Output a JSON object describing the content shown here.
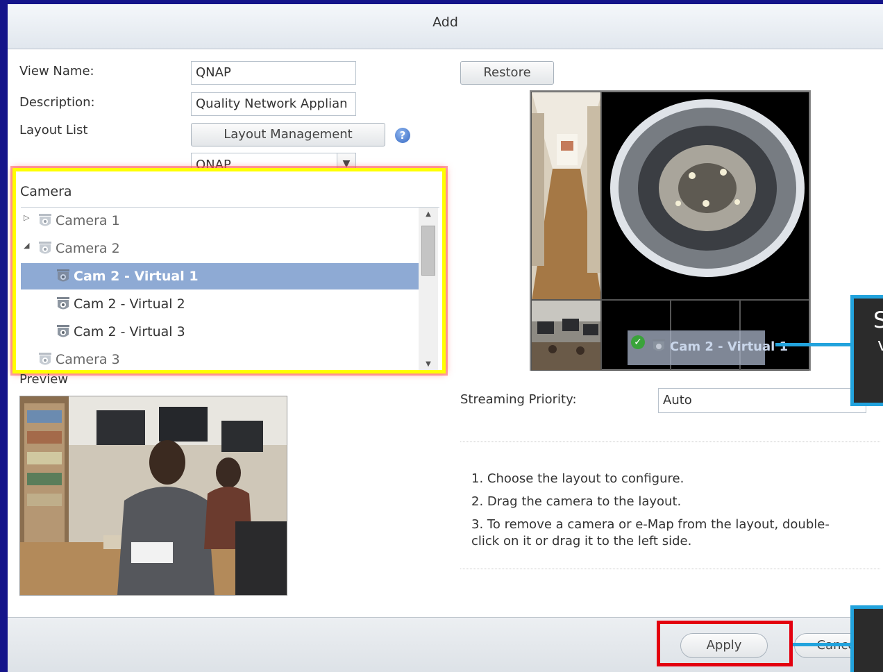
{
  "dialog": {
    "title": "Add"
  },
  "form": {
    "view_name_label": "View Name:",
    "view_name_value": "QNAP",
    "description_label": "Description:",
    "description_value": "Quality Network Applian",
    "layout_list_label": "Layout List",
    "layout_management_button": "Layout Management",
    "layout_select_value": "QNAP",
    "restore_button": "Restore"
  },
  "camera_panel": {
    "header": "Camera",
    "items": [
      {
        "label": "Camera 1",
        "level": 0,
        "expanded": false,
        "selected": false
      },
      {
        "label": "Camera 2",
        "level": 0,
        "expanded": true,
        "selected": false
      },
      {
        "label": "Cam 2 - Virtual 1",
        "level": 1,
        "selected": true
      },
      {
        "label": "Cam 2 - Virtual 2",
        "level": 1,
        "selected": false
      },
      {
        "label": "Cam 2 - Virtual 3",
        "level": 1,
        "selected": false
      },
      {
        "label": "Camera 3",
        "level": 0,
        "expanded": false,
        "selected": false
      }
    ]
  },
  "preview": {
    "label": "Preview"
  },
  "layout_drag": {
    "label": "Cam 2 - Virtual 1"
  },
  "streaming": {
    "label": "Streaming Priority:",
    "value": "Auto"
  },
  "instructions": {
    "line1": "1. Choose the layout to configure.",
    "line2": "2. Drag the camera to the layout.",
    "line3a": "3. To remove a camera or e-Map from the layout, double-",
    "line3b": "click on it or drag it to the left side."
  },
  "footer": {
    "apply_button": "Apply",
    "cancel_button": "Cancel"
  },
  "callouts": {
    "top_text": "S"
  },
  "colors": {
    "highlight_yellow": "#ffff00",
    "highlight_red": "#e3000f",
    "callout_blue": "#22a3dd",
    "selection": "#8eaad4",
    "background_frame": "#14148a"
  }
}
